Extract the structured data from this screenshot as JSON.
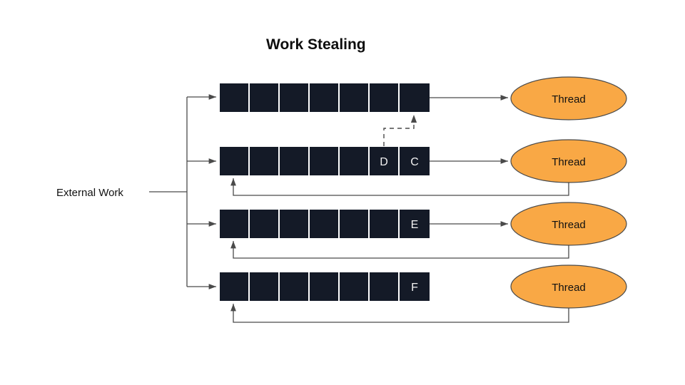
{
  "diagram": {
    "title": "Work Stealing",
    "external_work_label": "External Work",
    "background_color": "#ffffff",
    "queue_cell_color": "#141a27",
    "thread_fill_color": "#f9a845",
    "connector_color": "#4a4a4a",
    "cell_text_color": "#f2f2f2",
    "rows": [
      {
        "id": "row-1",
        "thread_label": "Thread",
        "cells": [
          "",
          "",
          "",
          "",
          "",
          "",
          ""
        ],
        "has_thread_arrow": true,
        "has_feedback_loop": false,
        "receives_stolen_task": true
      },
      {
        "id": "row-2",
        "thread_label": "Thread",
        "cells": [
          "",
          "",
          "",
          "",
          "",
          "D",
          "C"
        ],
        "has_thread_arrow": true,
        "has_feedback_loop": true,
        "donates_stolen_task": true
      },
      {
        "id": "row-3",
        "thread_label": "Thread",
        "cells": [
          "",
          "",
          "",
          "",
          "",
          "",
          "E"
        ],
        "has_thread_arrow": true,
        "has_feedback_loop": true
      },
      {
        "id": "row-4",
        "thread_label": "Thread",
        "cells": [
          "",
          "",
          "",
          "",
          "",
          "",
          "F"
        ],
        "has_thread_arrow": false,
        "has_feedback_loop": true
      }
    ],
    "steal_arrow": {
      "style": "dashed",
      "from_row": "row-2",
      "from_cell_label": "D",
      "to_row": "row-1"
    }
  }
}
